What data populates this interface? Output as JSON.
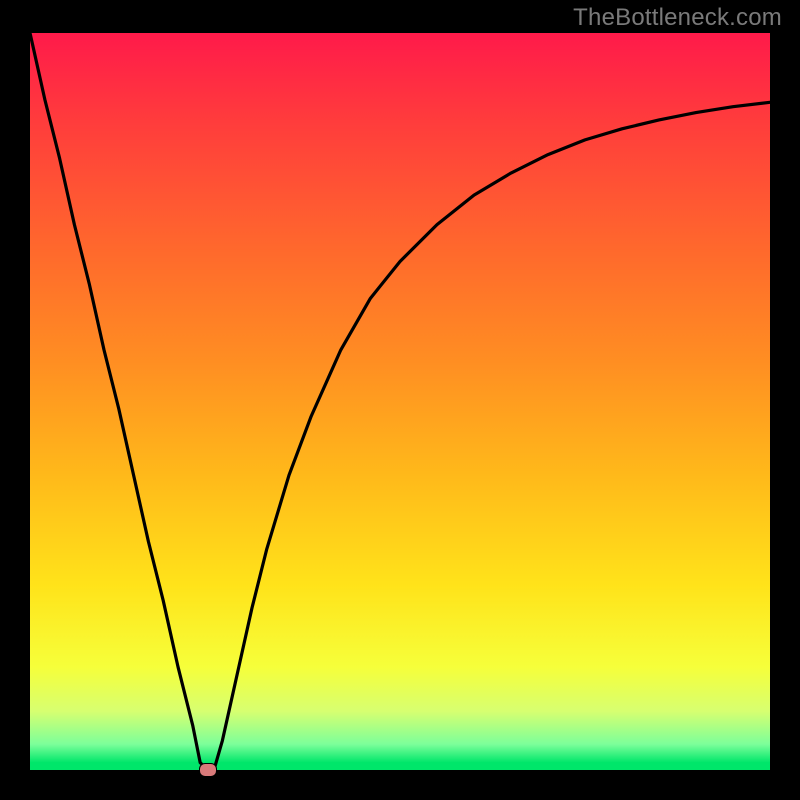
{
  "watermark": "TheBottleneck.com",
  "chart_data": {
    "type": "line",
    "title": "",
    "xlabel": "",
    "ylabel": "",
    "xlim": [
      0,
      100
    ],
    "ylim": [
      0,
      100
    ],
    "grid": false,
    "x": [
      0,
      2,
      4,
      6,
      8,
      10,
      12,
      14,
      16,
      18,
      20,
      22,
      23,
      24,
      25,
      26,
      28,
      30,
      32,
      35,
      38,
      42,
      46,
      50,
      55,
      60,
      65,
      70,
      75,
      80,
      85,
      90,
      95,
      100
    ],
    "y": [
      100,
      91,
      83,
      74,
      66,
      57,
      49,
      40,
      31,
      23,
      14,
      6,
      1,
      0,
      0.5,
      4,
      13,
      22,
      30,
      40,
      48,
      57,
      64,
      69,
      74,
      78,
      81,
      83.5,
      85.5,
      87,
      88.2,
      89.2,
      90,
      90.6
    ],
    "marker": {
      "x": 24,
      "y": 0,
      "color": "#d87a7a"
    },
    "gradient_stops": [
      {
        "pos": 0,
        "color": "#ff1a4a"
      },
      {
        "pos": 30,
        "color": "#ff6a2c"
      },
      {
        "pos": 60,
        "color": "#ffb91a"
      },
      {
        "pos": 86,
        "color": "#f6ff3a"
      },
      {
        "pos": 99,
        "color": "#00e66a"
      }
    ]
  }
}
